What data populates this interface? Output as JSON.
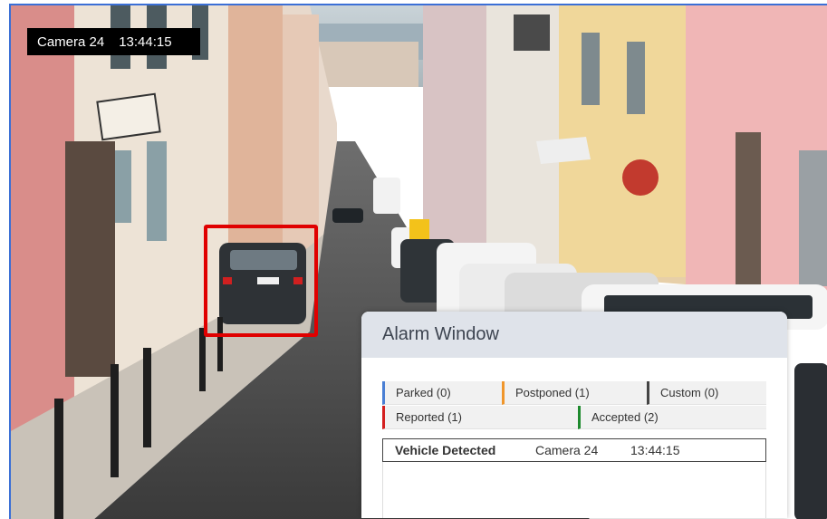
{
  "camera_overlay": {
    "camera": "Camera 24",
    "time": "13:44:15"
  },
  "alarm_window": {
    "title": "Alarm Window",
    "tabs": [
      {
        "label": "Parked (0)",
        "color": "#4a7fd4"
      },
      {
        "label": "Postponed (1)",
        "color": "#f0962b"
      },
      {
        "label": "Custom (0)",
        "color": "#444444"
      },
      {
        "label": "Reported (1)",
        "color": "#d42020"
      },
      {
        "label": "Accepted (2)",
        "color": "#1e8a2e"
      }
    ],
    "events": [
      {
        "type": "Vehicle Detected",
        "camera": "Camera 24",
        "time": "13:44:15"
      }
    ]
  },
  "colors": {
    "frame_border": "#3b6fd6",
    "detection_box": "#e00000"
  }
}
